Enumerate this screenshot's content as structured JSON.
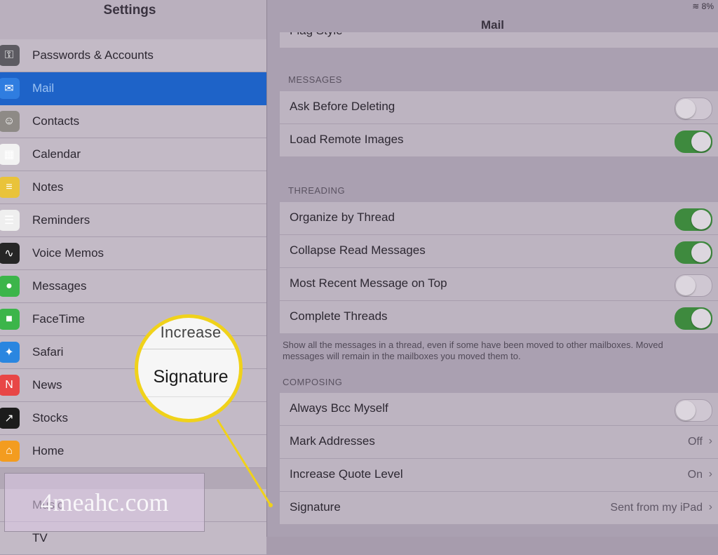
{
  "left": {
    "title": "Settings",
    "items": [
      {
        "label": "Passwords & Accounts",
        "icon": "key-icon",
        "color": "#5d5b62"
      },
      {
        "label": "Mail",
        "icon": "mail-icon",
        "color": "#2f7de0",
        "selected": true
      },
      {
        "label": "Contacts",
        "icon": "contacts-icon",
        "color": "#8e8a86"
      },
      {
        "label": "Calendar",
        "icon": "calendar-icon",
        "color": "#f2f2f2"
      },
      {
        "label": "Notes",
        "icon": "notes-icon",
        "color": "#e9c33a"
      },
      {
        "label": "Reminders",
        "icon": "reminders-icon",
        "color": "#efefef"
      },
      {
        "label": "Voice Memos",
        "icon": "voice-memos-icon",
        "color": "#262626"
      },
      {
        "label": "Messages",
        "icon": "messages-icon",
        "color": "#3cb54a"
      },
      {
        "label": "FaceTime",
        "icon": "facetime-icon",
        "color": "#3cb54a"
      },
      {
        "label": "Safari",
        "icon": "safari-icon",
        "color": "#2a86e0"
      },
      {
        "label": "News",
        "icon": "news-icon",
        "color": "#e84646"
      },
      {
        "label": "Stocks",
        "icon": "stocks-icon",
        "color": "#1c1c1c"
      },
      {
        "label": "Home",
        "icon": "home-icon",
        "color": "#f39c1f"
      }
    ],
    "bottom_items": [
      {
        "label": "Music"
      },
      {
        "label": "TV"
      }
    ]
  },
  "watermark": "4meahc.com",
  "right": {
    "title": "Mail",
    "status": "≋ 8%",
    "top_partial_row": "Flag Style",
    "messages": {
      "label": "MESSAGES",
      "rows": [
        {
          "label": "Ask Before Deleting",
          "toggle": false
        },
        {
          "label": "Load Remote Images",
          "toggle": true
        }
      ]
    },
    "threading": {
      "label": "THREADING",
      "rows": [
        {
          "label": "Organize by Thread",
          "toggle": true
        },
        {
          "label": "Collapse Read Messages",
          "toggle": true
        },
        {
          "label": "Most Recent Message on Top",
          "toggle": false
        },
        {
          "label": "Complete Threads",
          "toggle": true
        }
      ],
      "note": "Show all the messages in a thread, even if some have been moved to other mailboxes. Moved messages will remain in the mailboxes you moved them to."
    },
    "composing": {
      "label": "COMPOSING",
      "rows": [
        {
          "label": "Always Bcc Myself",
          "toggle": false
        },
        {
          "label": "Mark Addresses",
          "value": "Off"
        },
        {
          "label": "Increase Quote Level",
          "value": "On"
        },
        {
          "label": "Signature",
          "value": "Sent from my iPad"
        }
      ]
    }
  },
  "callout": {
    "top_text": "Increase",
    "main_text": "Signature",
    "ring_color": "#f0d21a"
  }
}
